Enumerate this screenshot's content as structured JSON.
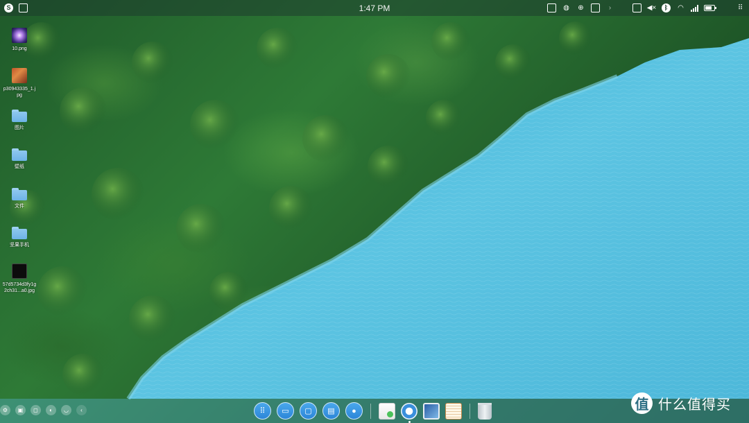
{
  "topbar": {
    "clock": "1:47 PM",
    "left_icons": [
      "system-menu-icon",
      "screenshot-icon"
    ],
    "right_icons": [
      "display-icon",
      "network-globe-icon",
      "search-icon",
      "screen-record-icon",
      "expand-arrow-icon",
      "keyboard-icon",
      "volume-muted-icon",
      "bluetooth-icon",
      "wifi-icon",
      "signal-icon",
      "battery-icon",
      "app-grid-icon"
    ]
  },
  "desktop": {
    "items": [
      {
        "label": "10.png",
        "type": "image"
      },
      {
        "label": "p30943335_1.jpg",
        "type": "image"
      },
      {
        "label": "图片",
        "type": "folder"
      },
      {
        "label": "壁纸",
        "type": "folder"
      },
      {
        "label": "文件",
        "type": "folder"
      },
      {
        "label": "坚果手机",
        "type": "folder"
      },
      {
        "label": "57d5734d3fy1g2ch31...a0.jpg",
        "type": "image"
      }
    ]
  },
  "bottombar": {
    "left_buttons": [
      "settings-icon",
      "multi-window-icon",
      "crop-icon",
      "toggle-icon",
      "cup-icon",
      "collapse-arrow-icon"
    ],
    "dock_system": [
      "launcher-icon",
      "windows-icon",
      "desktop-icon",
      "tasks-icon",
      "control-icon"
    ],
    "dock_apps": [
      "file-manager-app-icon",
      "browser-app-icon",
      "gallery-app-icon",
      "notes-app-icon",
      "trash-icon"
    ]
  },
  "watermark": {
    "logo": "值",
    "text": "什么值得买"
  },
  "colors": {
    "forest": "#1f5a2a",
    "lake": "#56bfe0",
    "dock_blue": "#2c86d8"
  }
}
